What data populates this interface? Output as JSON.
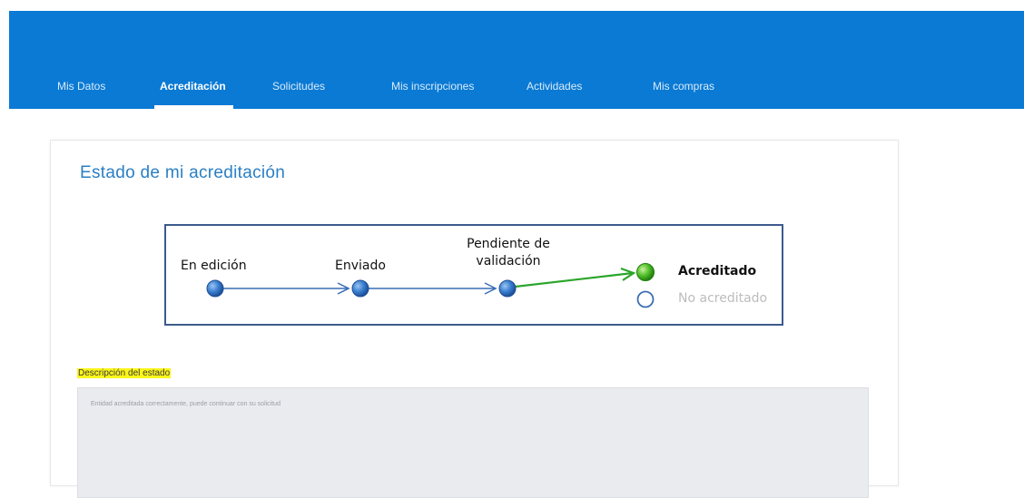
{
  "nav": {
    "tabs": [
      {
        "label": "Mis Datos",
        "active": false
      },
      {
        "label": "Acreditación",
        "active": true
      },
      {
        "label": "Solicitudes",
        "active": false
      },
      {
        "label": "Mis inscripciones",
        "active": false
      },
      {
        "label": "Actividades",
        "active": false
      },
      {
        "label": "Mis compras",
        "active": false
      }
    ]
  },
  "page": {
    "title": "Estado de mi acreditación"
  },
  "status_flow": {
    "steps": [
      {
        "label": "En edición"
      },
      {
        "label": "Enviado"
      },
      {
        "label": "Pendiente de validación",
        "line1": "Pendiente de",
        "line2": "validación"
      }
    ],
    "outcomes": [
      {
        "label": "Acreditado",
        "selected": true
      },
      {
        "label": "No acreditado",
        "selected": false
      }
    ],
    "colors": {
      "step": "#2f6fc0",
      "line": "#3a6db5",
      "success": "#2aa52a",
      "outline": "#3c5a8c"
    }
  },
  "description": {
    "label": "Descripción del estado",
    "text": "Entidad acreditada correctamente, puede continuar con su solicitud"
  }
}
